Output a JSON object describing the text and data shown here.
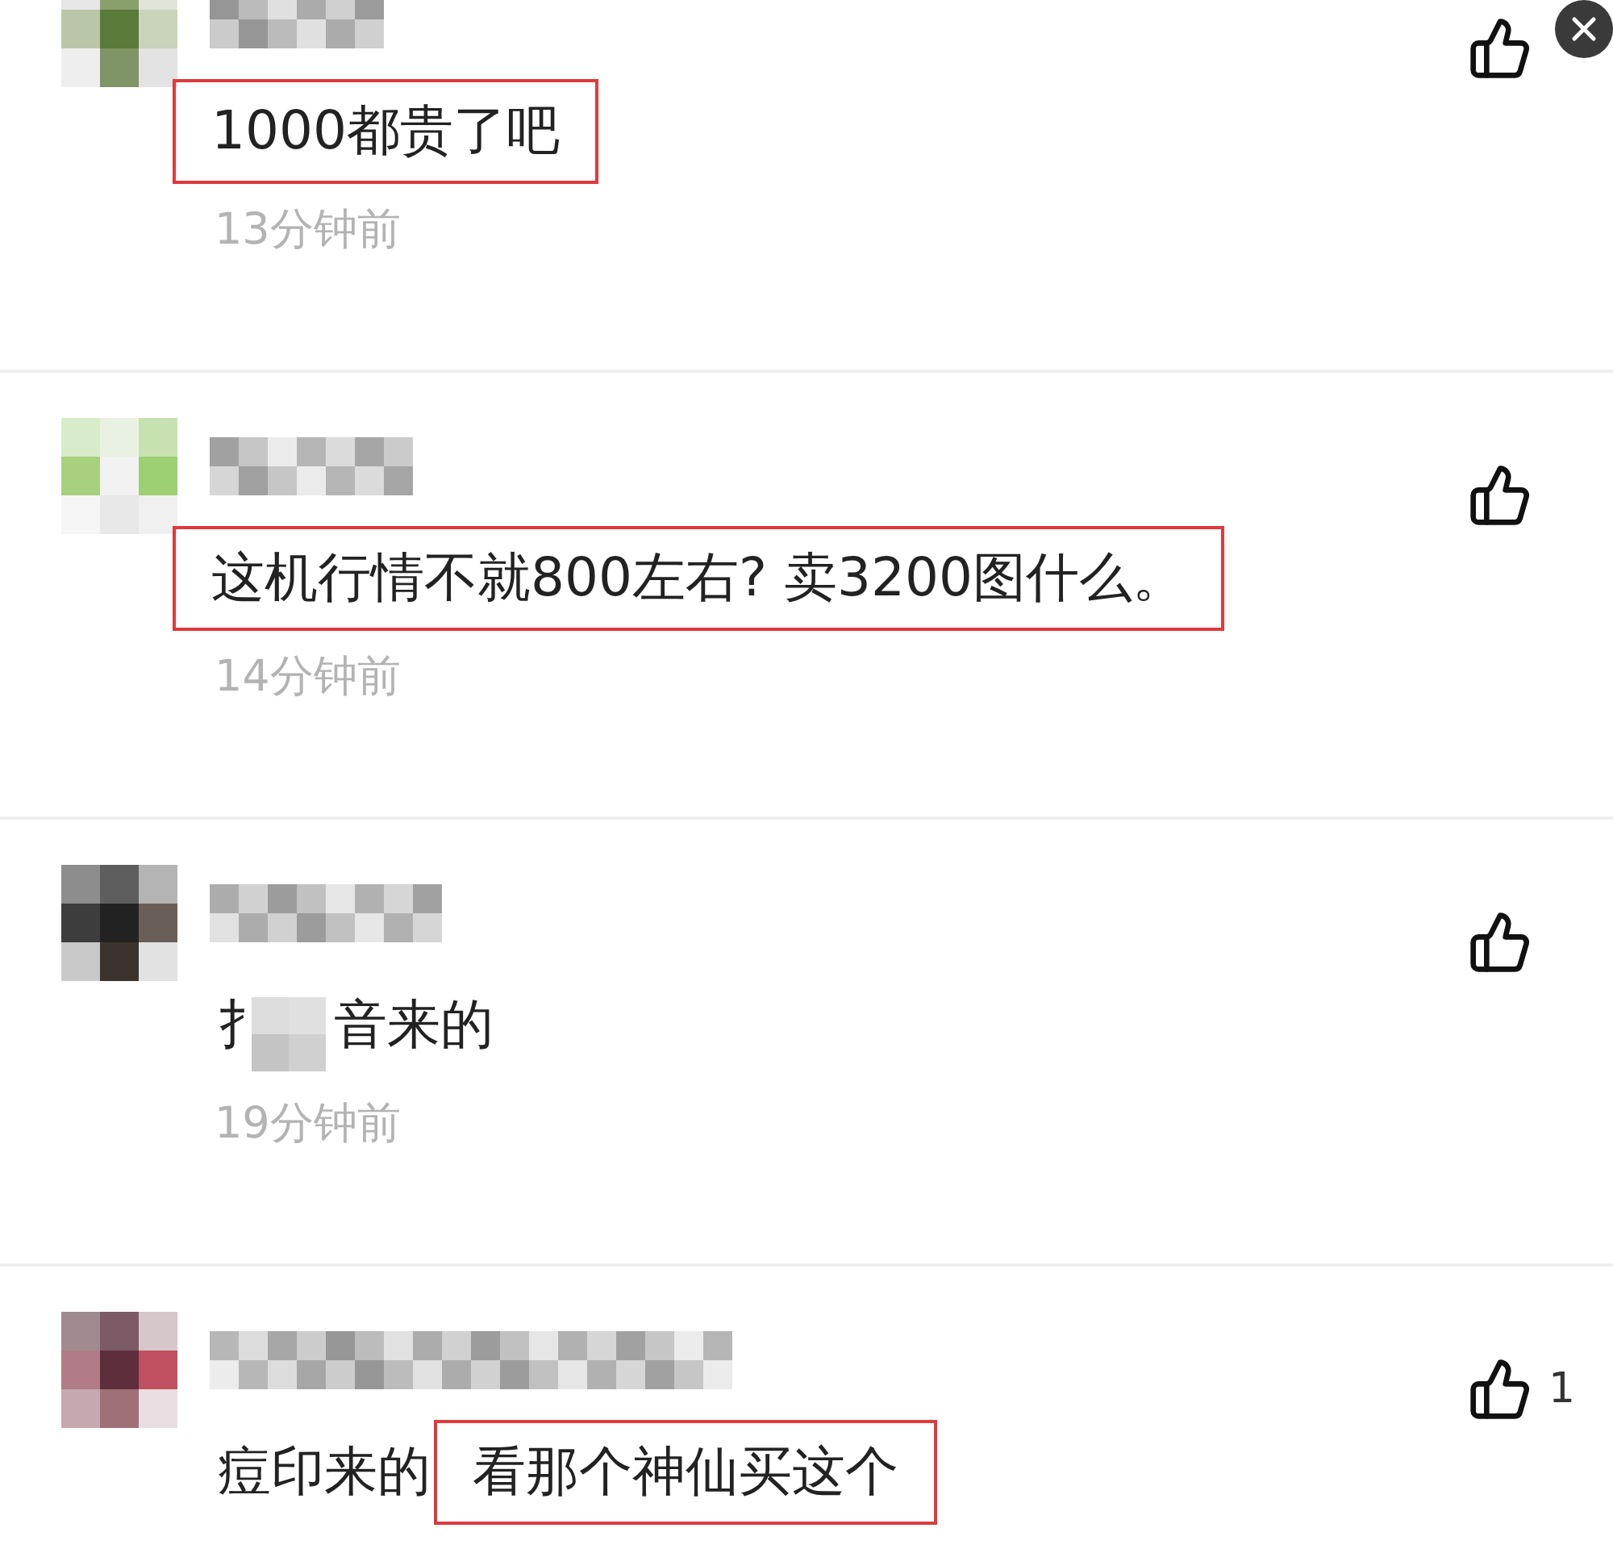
{
  "comments": [
    {
      "segments": [
        {
          "kind": "text",
          "text": "1000都贵了吧",
          "highlighted": true
        }
      ],
      "time": "13分钟前"
    },
    {
      "segments": [
        {
          "kind": "text",
          "text": "这机行情不就800左右? 卖3200图什么。",
          "highlighted": true
        }
      ],
      "time": "14分钟前"
    },
    {
      "segments": [
        {
          "kind": "text",
          "text": "扌",
          "highlighted": false
        },
        {
          "kind": "redacted"
        },
        {
          "kind": "text",
          "text": "音来的",
          "highlighted": false
        }
      ],
      "time": "19分钟前"
    },
    {
      "segments": [
        {
          "kind": "text",
          "text": "痘印来的",
          "highlighted": false
        },
        {
          "kind": "text",
          "text": "看那个神仙买这个",
          "highlighted": true
        }
      ],
      "likes": "1"
    }
  ]
}
